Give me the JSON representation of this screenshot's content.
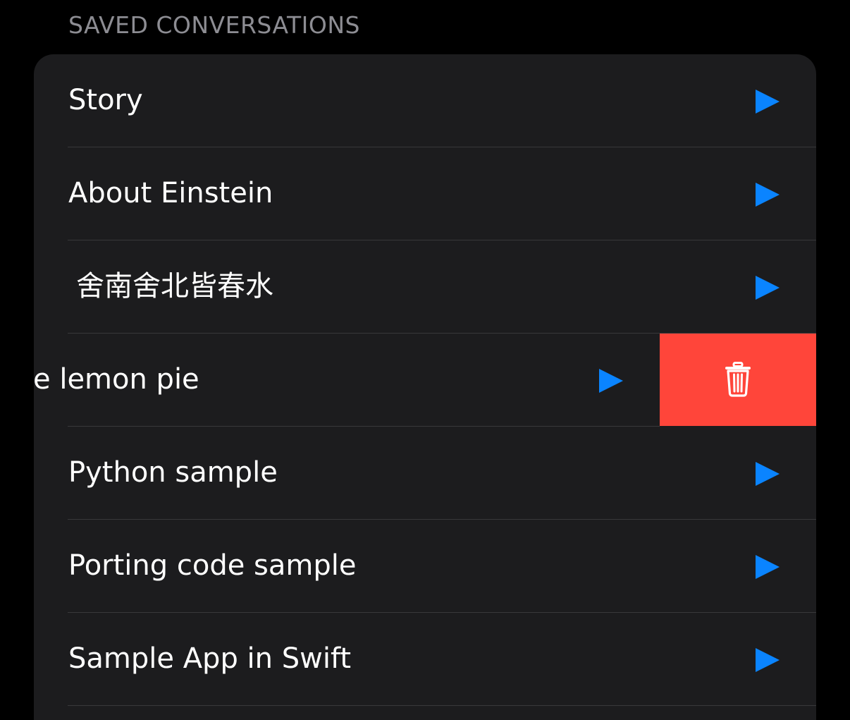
{
  "section": {
    "header": "SAVED CONVERSATIONS"
  },
  "conversations": [
    {
      "title": "Story",
      "action_icon": "play-icon"
    },
    {
      "title": "About Einstein",
      "action_icon": "play-icon"
    },
    {
      "title": "舍南舍北皆春水",
      "action_icon": "play-icon"
    },
    {
      "title": "e lemon pie",
      "action_icon": "play-icon",
      "swiped": true,
      "trailing_action_icon": "trash-icon"
    },
    {
      "title": "Python sample",
      "action_icon": "play-icon"
    },
    {
      "title": "Porting code sample",
      "action_icon": "play-icon"
    },
    {
      "title": "Sample App in Swift",
      "action_icon": "play-icon"
    }
  ],
  "colors": {
    "background": "#000000",
    "card": "#1c1c1e",
    "separator": "#38383a",
    "accent": "#0a84ff",
    "destructive": "#ff453a",
    "header_text": "#8d8d93"
  }
}
